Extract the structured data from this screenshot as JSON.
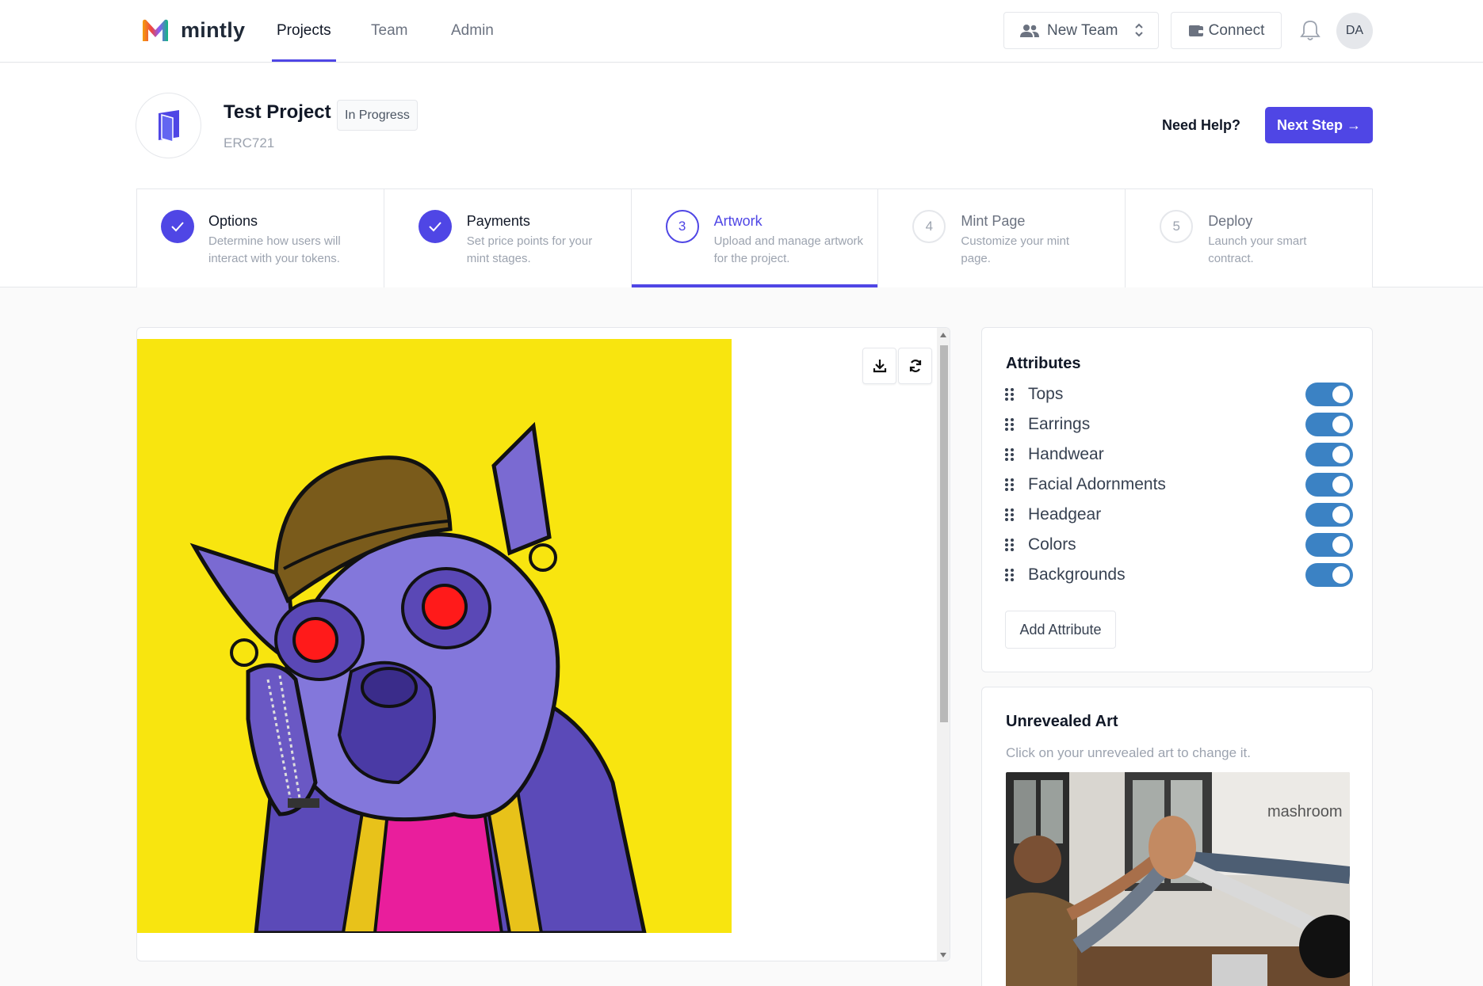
{
  "app": {
    "name": "mintly"
  },
  "nav": {
    "tabs": [
      {
        "label": "Projects"
      },
      {
        "label": "Team"
      },
      {
        "label": "Admin"
      }
    ],
    "team_select": "New Team",
    "connect_label": "Connect",
    "avatar_initials": "DA"
  },
  "project": {
    "title": "Test Project",
    "status": "In Progress",
    "standard": "ERC721",
    "need_help": "Need Help?",
    "next_step": "Next Step →"
  },
  "steps": [
    {
      "title": "Options",
      "desc": "Determine how users will interact with your tokens.",
      "state": "done"
    },
    {
      "title": "Payments",
      "desc": "Set price points for your mint stages.",
      "state": "done"
    },
    {
      "number": "3",
      "title": "Artwork",
      "desc": "Upload and manage artwork for the project.",
      "state": "current"
    },
    {
      "number": "4",
      "title": "Mint Page",
      "desc": "Customize your mint page.",
      "state": "todo"
    },
    {
      "number": "5",
      "title": "Deploy",
      "desc": "Launch your smart contract.",
      "state": "todo"
    }
  ],
  "attributes": {
    "title": "Attributes",
    "items": [
      {
        "label": "Tops",
        "enabled": true
      },
      {
        "label": "Earrings",
        "enabled": true
      },
      {
        "label": "Handwear",
        "enabled": true
      },
      {
        "label": "Facial Adornments",
        "enabled": true
      },
      {
        "label": "Headgear",
        "enabled": true
      },
      {
        "label": "Colors",
        "enabled": true
      },
      {
        "label": "Backgrounds",
        "enabled": true
      }
    ],
    "add_label": "Add Attribute"
  },
  "unrevealed": {
    "title": "Unrevealed Art",
    "subtitle": "Click on your unrevealed art to change it.",
    "wall_text": "mashroom"
  },
  "colors": {
    "accent": "#4f46e5",
    "toggle_on": "#3b82c4",
    "art_background": "#f8e50f"
  },
  "icons": {
    "download": "download-icon",
    "refresh": "refresh-icon",
    "bell": "bell-icon",
    "wallet": "wallet-icon",
    "users": "users-icon"
  }
}
